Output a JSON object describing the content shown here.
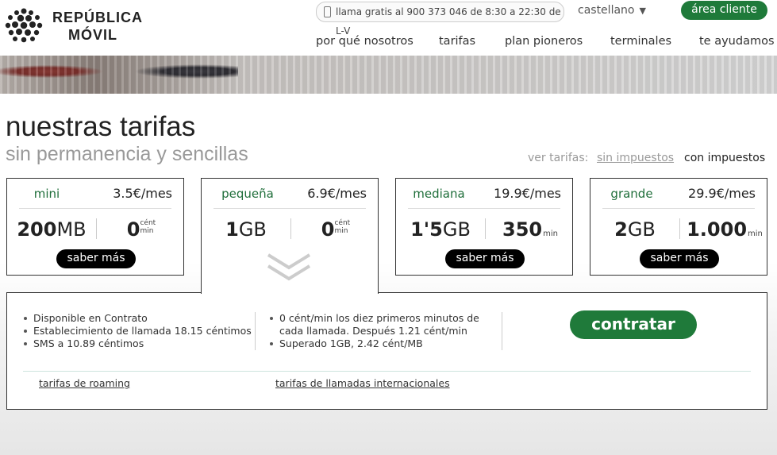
{
  "brand": {
    "line1": "REPÚBLICA",
    "line2": "MÓVIL"
  },
  "topbar": {
    "phone": "llama gratis al 900 373 046 de 8:30 a 22:30 de L-V",
    "language": "castellano",
    "area_cliente": "área cliente"
  },
  "nav": [
    "por qué nosotros",
    "tarifas",
    "plan pioneros",
    "terminales",
    "te ayudamos"
  ],
  "page": {
    "title": "nuestras tarifas",
    "subtitle": "sin permanencia y sencillas"
  },
  "tax_toggle": {
    "label": "ver tarifas:",
    "without": "sin impuestos",
    "with": "con impuestos"
  },
  "cards": [
    {
      "name": "mini",
      "price": "3.5€/mes",
      "data_num": "200",
      "data_unit": "MB",
      "mins": "0",
      "mins_unit_top": "cént",
      "mins_unit_bottom": "min",
      "button": "saber más"
    },
    {
      "name": "pequeña",
      "price": "6.9€/mes",
      "data_num": "1",
      "data_unit": "GB",
      "mins": "0",
      "mins_unit_top": "cént",
      "mins_unit_bottom": "min",
      "button": ""
    },
    {
      "name": "mediana",
      "price": "19.9€/mes",
      "data_num": "1'5",
      "data_unit": "GB",
      "mins": "350",
      "mins_unit": "min",
      "button": "saber más"
    },
    {
      "name": "grande",
      "price": "29.9€/mes",
      "data_num": "2",
      "data_unit": "GB",
      "mins": "1.000",
      "mins_unit": "min",
      "button": "saber más"
    }
  ],
  "detail": {
    "col1": [
      "Disponible en Contrato",
      "Establecimiento de llamada 18.15 céntimos",
      "SMS a 10.89 céntimos"
    ],
    "col2": [
      "0 cént/min los diez primeros minutos de cada llamada. Después 1.21 cént/min",
      "Superado 1GB, 2.42 cént/MB"
    ],
    "button": "contratar",
    "link_roaming": "tarifas de roaming",
    "link_international": "tarifas de llamadas internacionales"
  },
  "colors": {
    "brand_green": "#1f7a3a",
    "name_green": "#1f6e3a",
    "border": "#333333"
  }
}
